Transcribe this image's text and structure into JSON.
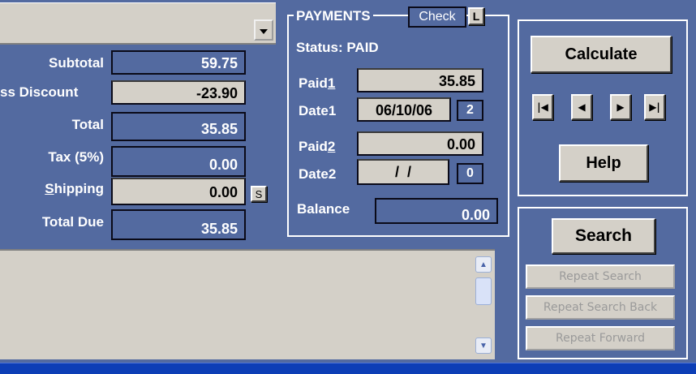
{
  "totals": {
    "subtotal": {
      "label": "Subtotal",
      "value": "59.75"
    },
    "discount": {
      "label": "ss Discount",
      "value": "-23.90"
    },
    "total": {
      "label": "Total",
      "value": "35.85"
    },
    "tax": {
      "label": "Tax (5%)",
      "value": "0.00"
    },
    "shipping": {
      "label_rest": "hipping",
      "label_ul": "S",
      "value": "0.00",
      "button": "S"
    },
    "total_due": {
      "label": "Total Due",
      "value": "35.85"
    }
  },
  "payments": {
    "title": "PAYMENTS",
    "check_label": "Check",
    "l_button": "L",
    "status": "Status: PAID",
    "paid1": {
      "label": "Paid",
      "label_ul": "1",
      "value": "35.85"
    },
    "date1": {
      "label": "Date1",
      "value": "06/10/06",
      "count": "2"
    },
    "paid2": {
      "label": "Paid",
      "label_ul": "2",
      "value": "0.00"
    },
    "date2": {
      "label": "Date2",
      "value": " /  / ",
      "count": "0"
    },
    "balance": {
      "label": "Balance",
      "value": "0.00"
    }
  },
  "actions": {
    "calculate": "Calculate",
    "nav_first": "|◀",
    "nav_prev": "◀",
    "nav_next": "▶",
    "nav_last": "▶|",
    "help": "Help"
  },
  "search": {
    "search": "Search",
    "repeat_search": "Repeat Search",
    "repeat_back": "Repeat Search Back",
    "repeat_forward": "Repeat Forward"
  }
}
